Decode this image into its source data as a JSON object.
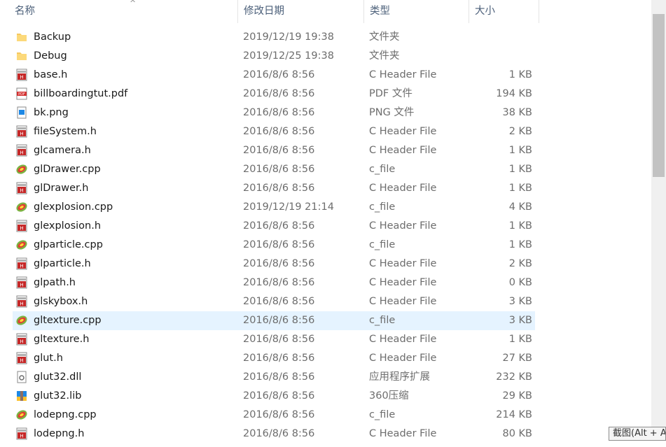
{
  "header": {
    "name_label": "名称",
    "date_label": "修改日期",
    "type_label": "类型",
    "size_label": "大小",
    "sort_glyph": "^"
  },
  "colors": {
    "selected_row": "#e5f3ff",
    "header_text": "#4c607a",
    "folder": "#f6c85f",
    "header_icon_red": "#c62828"
  },
  "files": [
    {
      "name": "Backup",
      "date": "2019/12/19 19:38",
      "type": "文件夹",
      "size": "",
      "icon": "folder-icon"
    },
    {
      "name": "Debug",
      "date": "2019/12/25 19:38",
      "type": "文件夹",
      "size": "",
      "icon": "folder-icon"
    },
    {
      "name": "base.h",
      "date": "2016/8/6 8:56",
      "type": "C Header File",
      "size": "1 KB",
      "icon": "c-header-file-icon"
    },
    {
      "name": "billboardingtut.pdf",
      "date": "2016/8/6 8:56",
      "type": "PDF 文件",
      "size": "194 KB",
      "icon": "pdf-file-icon"
    },
    {
      "name": "bk.png",
      "date": "2016/8/6 8:56",
      "type": "PNG 文件",
      "size": "38 KB",
      "icon": "png-file-icon"
    },
    {
      "name": "fileSystem.h",
      "date": "2016/8/6 8:56",
      "type": "C Header File",
      "size": "2 KB",
      "icon": "c-header-file-icon"
    },
    {
      "name": "glcamera.h",
      "date": "2016/8/6 8:56",
      "type": "C Header File",
      "size": "1 KB",
      "icon": "c-header-file-icon"
    },
    {
      "name": "glDrawer.cpp",
      "date": "2016/8/6 8:56",
      "type": "c_file",
      "size": "1 KB",
      "icon": "cpp-file-icon"
    },
    {
      "name": "glDrawer.h",
      "date": "2016/8/6 8:56",
      "type": "C Header File",
      "size": "1 KB",
      "icon": "c-header-file-icon"
    },
    {
      "name": "glexplosion.cpp",
      "date": "2019/12/19 21:14",
      "type": "c_file",
      "size": "4 KB",
      "icon": "cpp-file-icon"
    },
    {
      "name": "glexplosion.h",
      "date": "2016/8/6 8:56",
      "type": "C Header File",
      "size": "1 KB",
      "icon": "c-header-file-icon"
    },
    {
      "name": "glparticle.cpp",
      "date": "2016/8/6 8:56",
      "type": "c_file",
      "size": "1 KB",
      "icon": "cpp-file-icon"
    },
    {
      "name": "glparticle.h",
      "date": "2016/8/6 8:56",
      "type": "C Header File",
      "size": "2 KB",
      "icon": "c-header-file-icon"
    },
    {
      "name": "glpath.h",
      "date": "2016/8/6 8:56",
      "type": "C Header File",
      "size": "0 KB",
      "icon": "c-header-file-icon"
    },
    {
      "name": "glskybox.h",
      "date": "2016/8/6 8:56",
      "type": "C Header File",
      "size": "3 KB",
      "icon": "c-header-file-icon"
    },
    {
      "name": "gltexture.cpp",
      "date": "2016/8/6 8:56",
      "type": "c_file",
      "size": "3 KB",
      "icon": "cpp-file-icon",
      "selected": true
    },
    {
      "name": "gltexture.h",
      "date": "2016/8/6 8:56",
      "type": "C Header File",
      "size": "1 KB",
      "icon": "c-header-file-icon"
    },
    {
      "name": "glut.h",
      "date": "2016/8/6 8:56",
      "type": "C Header File",
      "size": "27 KB",
      "icon": "c-header-file-icon"
    },
    {
      "name": "glut32.dll",
      "date": "2016/8/6 8:56",
      "type": "应用程序扩展",
      "size": "232 KB",
      "icon": "dll-file-icon"
    },
    {
      "name": "glut32.lib",
      "date": "2016/8/6 8:56",
      "type": "360压缩",
      "size": "29 KB",
      "icon": "lib-file-icon"
    },
    {
      "name": "lodepng.cpp",
      "date": "2016/8/6 8:56",
      "type": "c_file",
      "size": "214 KB",
      "icon": "cpp-file-icon"
    },
    {
      "name": "lodepng.h",
      "date": "2016/8/6 8:56",
      "type": "C Header File",
      "size": "80 KB",
      "icon": "c-header-file-icon"
    }
  ],
  "tooltip": {
    "text": "截图(Alt + A)"
  }
}
